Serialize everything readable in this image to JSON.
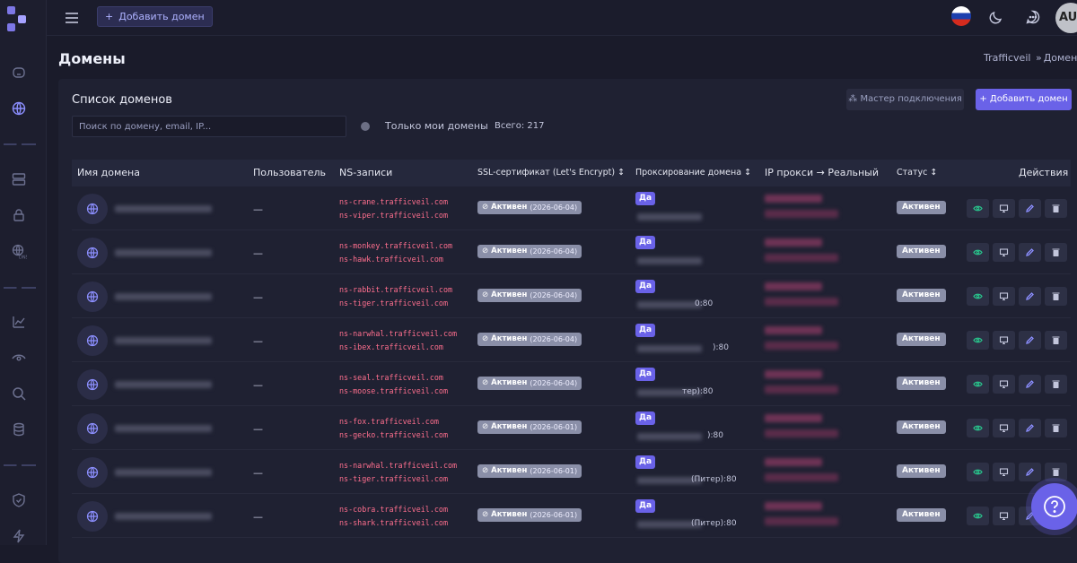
{
  "topbar": {
    "add_domain_label": "Добавить домен",
    "avatar_initials": "AU"
  },
  "page": {
    "title": "Домены",
    "breadcrumb": [
      "Trafficveil",
      "Домены"
    ]
  },
  "card": {
    "title": "Список доменов",
    "search_placeholder": "Поиск по домену, email, IP...",
    "only_mine_label": "Только мои домены",
    "total_label": "Всего: 217",
    "wizard_label": "Мастер подключения",
    "add_label": "Добавить домен"
  },
  "table": {
    "headers": {
      "name": "Имя домена",
      "user": "Пользователь",
      "ns": "NS-записи",
      "ssl": "SSL-сертификат (Let's Encrypt)",
      "proxy": "Проксирование домена",
      "ip": "IP прокси → Реальный",
      "status": "Статус",
      "actions": "Действия"
    },
    "rows": [
      {
        "user": "—",
        "ns1": "ns-crane.trafficveil.com",
        "ns2": "ns-viper.trafficveil.com",
        "ssl_status": "Активен",
        "ssl_date": "(2026-06-04)",
        "proxy": "Да",
        "proxy_text": "",
        "status": "Активен"
      },
      {
        "user": "—",
        "ns1": "ns-monkey.trafficveil.com",
        "ns2": "ns-hawk.trafficveil.com",
        "ssl_status": "Активен",
        "ssl_date": "(2026-06-04)",
        "proxy": "Да",
        "proxy_text": "",
        "status": "Активен"
      },
      {
        "user": "—",
        "ns1": "ns-rabbit.trafficveil.com",
        "ns2": "ns-tiger.trafficveil.com",
        "ssl_status": "Активен",
        "ssl_date": "(2026-06-04)",
        "proxy": "Да",
        "proxy_text": "0:80",
        "status": "Активен"
      },
      {
        "user": "—",
        "ns1": "ns-narwhal.trafficveil.com",
        "ns2": "ns-ibex.trafficveil.com",
        "ssl_status": "Активен",
        "ssl_date": "(2026-06-04)",
        "proxy": "Да",
        "proxy_text": "):80",
        "status": "Активен"
      },
      {
        "user": "—",
        "ns1": "ns-seal.trafficveil.com",
        "ns2": "ns-moose.trafficveil.com",
        "ssl_status": "Активен",
        "ssl_date": "(2026-06-04)",
        "proxy": "Да",
        "proxy_text": "тер):80",
        "status": "Активен"
      },
      {
        "user": "—",
        "ns1": "ns-fox.trafficveil.com",
        "ns2": "ns-gecko.trafficveil.com",
        "ssl_status": "Активен",
        "ssl_date": "(2026-06-01)",
        "proxy": "Да",
        "proxy_text": "):80",
        "status": "Активен"
      },
      {
        "user": "—",
        "ns1": "ns-narwhal.trafficveil.com",
        "ns2": "ns-tiger.trafficveil.com",
        "ssl_status": "Активен",
        "ssl_date": "(2026-06-01)",
        "proxy": "Да",
        "proxy_text": "(Питер):80",
        "status": "Активен"
      },
      {
        "user": "—",
        "ns1": "ns-cobra.trafficveil.com",
        "ns2": "ns-shark.trafficveil.com",
        "ssl_status": "Активен",
        "ssl_date": "(2026-06-01)",
        "proxy": "Да",
        "proxy_text": "(Питер):80",
        "status": "Активен"
      }
    ]
  },
  "colors": {
    "accent": "#6a62e8",
    "ns_text": "#ff6f8e",
    "badge_gray": "#8a8fa8",
    "view_icon": "#29c08a",
    "edit_icon": "#8c8fff",
    "delete_icon": "#c3c6dc"
  }
}
